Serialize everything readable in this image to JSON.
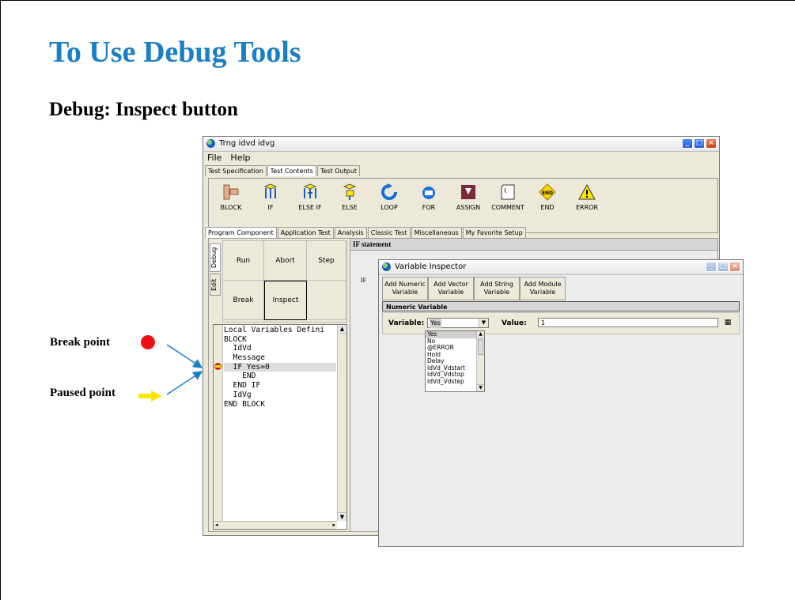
{
  "slide": {
    "title": "To Use Debug Tools",
    "subtitle": "Debug: Inspect button",
    "break_point_label": "Break point",
    "paused_point_label": "Paused point",
    "title_color": "#1a7fc4",
    "break_dot_color": "#ee1111",
    "paused_arrow_color": "#ffe600"
  },
  "main_window": {
    "title": "Trng idvd idvg",
    "menu": [
      "File",
      "Help"
    ],
    "tabs": [
      "Test Specification",
      "Test Contents",
      "Test Output"
    ],
    "active_tab": "Test Contents",
    "tools": [
      {
        "label": "BLOCK",
        "icon": "block-icon"
      },
      {
        "label": "IF",
        "icon": "if-icon"
      },
      {
        "label": "ELSE IF",
        "icon": "else-if-icon"
      },
      {
        "label": "ELSE",
        "icon": "else-icon"
      },
      {
        "label": "LOOP",
        "icon": "loop-icon"
      },
      {
        "label": "FOR",
        "icon": "for-icon"
      },
      {
        "label": "ASSIGN",
        "icon": "assign-icon"
      },
      {
        "label": "COMMENT",
        "icon": "comment-icon"
      },
      {
        "label": "END",
        "icon": "end-icon"
      },
      {
        "label": "ERROR",
        "icon": "error-icon"
      }
    ],
    "component_tabs": [
      "Program Component",
      "Application Test",
      "Analysis",
      "Classic Test",
      "Miscellaneous",
      "My Favorite Setup"
    ],
    "side_tabs": [
      "Debug",
      "Edit"
    ],
    "debug_buttons": {
      "run": "Run",
      "abort": "Abort",
      "step": "Step",
      "break": "Break",
      "inspect": "Inspect"
    },
    "code_lines": [
      "Local Variables Defini",
      "BLOCK",
      "  IdVd",
      "  Message",
      "  IF Yes=0",
      "    END",
      "  END IF",
      "  IdVg",
      "END BLOCK"
    ],
    "paused_line_index": 4,
    "if_header": "IF statement",
    "if_label": "IF"
  },
  "inspector": {
    "title": "Variable Inspector",
    "buttons": [
      {
        "line1": "Add Numeric",
        "line2": "Variable"
      },
      {
        "line1": "Add Vector",
        "line2": "Variable"
      },
      {
        "line1": "Add String",
        "line2": "Variable"
      },
      {
        "line1": "Add Module",
        "line2": "Variable"
      }
    ],
    "section_header": "Numeric Variable",
    "variable_label": "Variable:",
    "variable_value": "Yes",
    "value_label": "Value:",
    "value": "1",
    "options": [
      "Yes",
      "No",
      "@ERROR",
      "Hold",
      "Delay",
      "IdVd_Vdstart",
      "IdVd_Vdstop",
      "IdVd_Vdstep"
    ]
  }
}
